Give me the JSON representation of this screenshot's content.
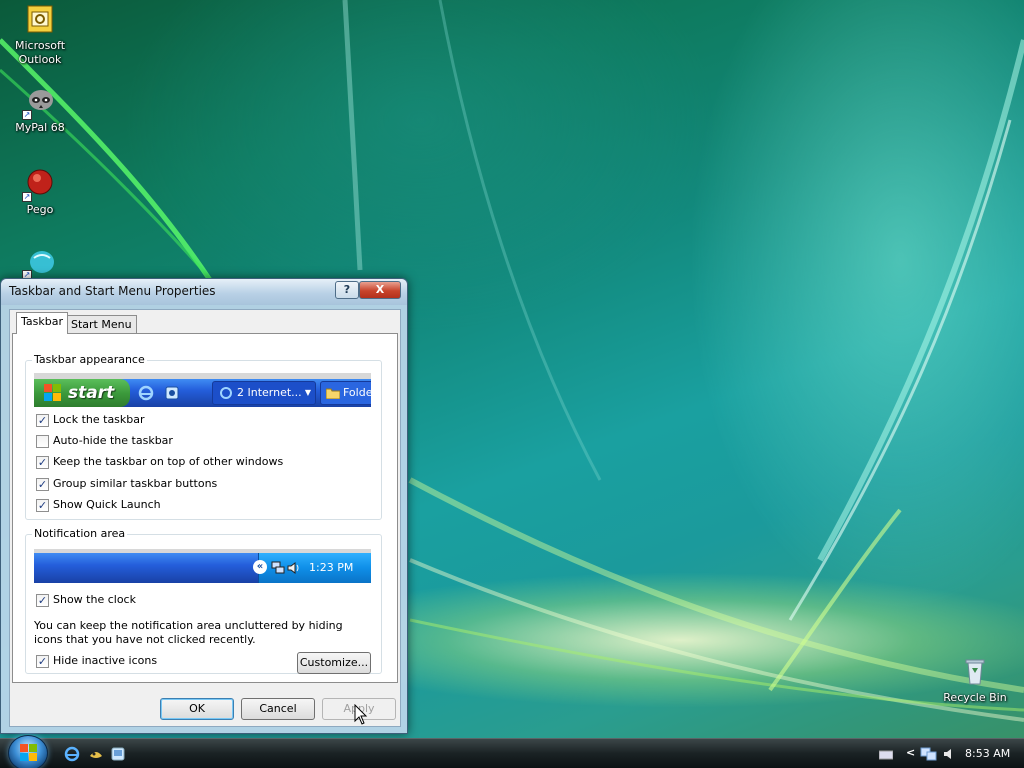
{
  "desktop": {
    "icons": [
      {
        "label": "Microsoft Outlook",
        "icon": "outlook-icon"
      },
      {
        "label": "MyPal 68",
        "icon": "mypal-raccoon-icon"
      },
      {
        "label": "Pego",
        "icon": "pego-icon"
      },
      {
        "label": "",
        "icon": "app-globe-icon"
      },
      {
        "label": "Recycle Bin",
        "icon": "recycle-bin-icon"
      }
    ]
  },
  "dialog": {
    "title": "Taskbar and Start Menu Properties",
    "help_symbol": "?",
    "close_symbol": "X",
    "tabs": [
      {
        "label": "Taskbar",
        "active": true
      },
      {
        "label": "Start Menu",
        "active": false
      }
    ],
    "taskbar_appearance": {
      "group_label": "Taskbar appearance",
      "preview": {
        "start_label": "start",
        "group_button_label": "2 Internet...",
        "folder_button_label": "Folde"
      },
      "options": [
        {
          "label": "Lock the taskbar",
          "checked": true
        },
        {
          "label": "Auto-hide the taskbar",
          "checked": false
        },
        {
          "label": "Keep the taskbar on top of other windows",
          "checked": true
        },
        {
          "label": "Group similar taskbar buttons",
          "checked": true
        },
        {
          "label": "Show Quick Launch",
          "checked": true
        }
      ]
    },
    "notification_area": {
      "group_label": "Notification area",
      "preview": {
        "clock": "1:23 PM",
        "expand_symbol": "«"
      },
      "show_clock": {
        "label": "Show the clock",
        "checked": true
      },
      "description": "You can keep the notification area uncluttered by hiding icons that you have not clicked recently.",
      "hide_inactive": {
        "label": "Hide inactive icons",
        "checked": true
      },
      "customize_label": "Customize..."
    },
    "buttons": {
      "ok": "OK",
      "cancel": "Cancel",
      "apply": "Apply"
    }
  },
  "taskbar": {
    "quick_launch": [
      "internet-explorer-icon",
      "mypal-icon",
      "show-desktop-icon"
    ],
    "tray_chevron": "<",
    "clock": "8:53 AM"
  },
  "colors": {
    "xp_taskbar_blue": "#245edb",
    "xp_start_green": "#3c9a3c",
    "vista_glass": "#bed7eb"
  }
}
